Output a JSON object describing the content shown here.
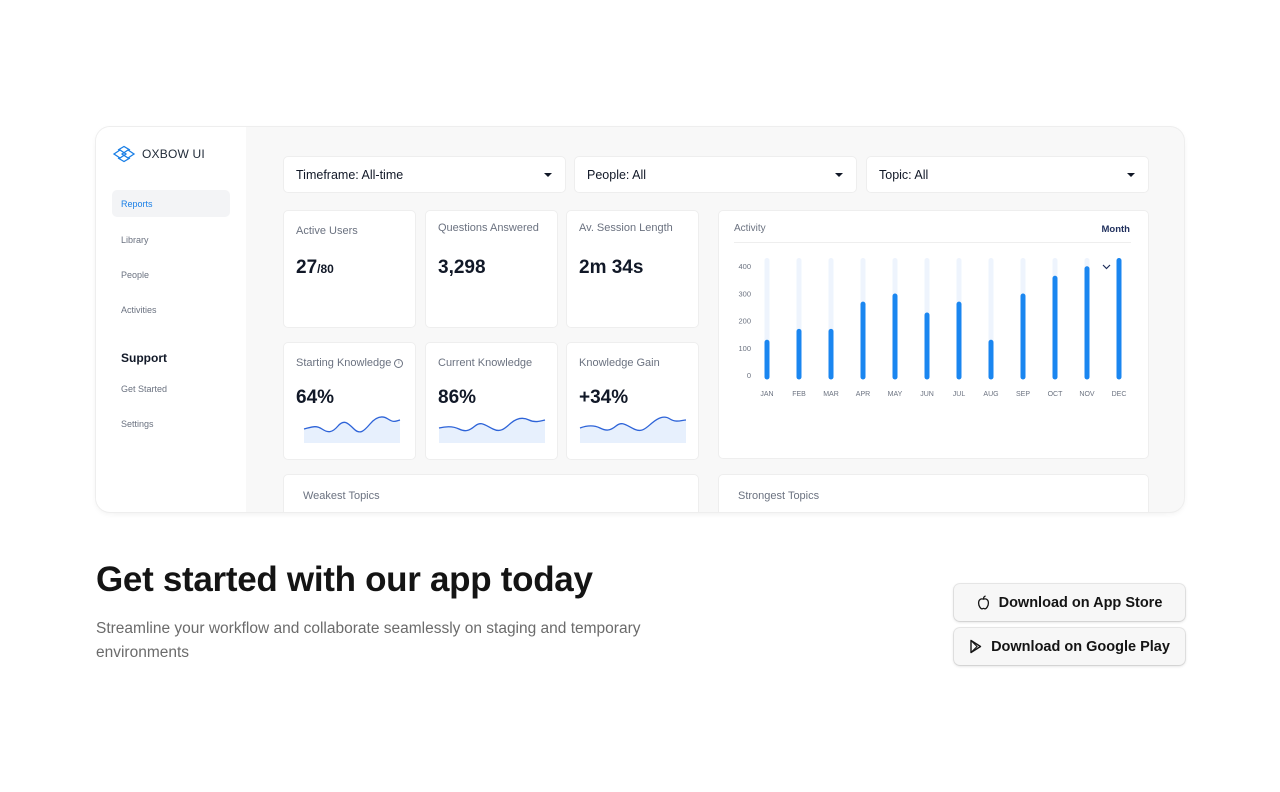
{
  "brand": {
    "name": "OXBOW UI",
    "icon": "oxbow-logo-icon",
    "accent": "#1a7fe6"
  },
  "sidebar": {
    "items": [
      {
        "label": "Reports",
        "active": true
      },
      {
        "label": "Library"
      },
      {
        "label": "People"
      },
      {
        "label": "Activities"
      }
    ],
    "support_heading": "Support",
    "support_items": [
      {
        "label": "Get Started"
      },
      {
        "label": "Settings"
      }
    ]
  },
  "filters": [
    {
      "label": "Timeframe: All-time"
    },
    {
      "label": "People: All"
    },
    {
      "label": "Topic: All"
    }
  ],
  "stats": {
    "active_users": {
      "label": "Active Users",
      "value": "27",
      "suffix": "/80"
    },
    "questions": {
      "label": "Questions Answered",
      "value": "3,298"
    },
    "session": {
      "label": "Av. Session Length",
      "value": "2m 34s"
    },
    "starting": {
      "label": "Starting Knowledge",
      "value": "64%",
      "info_icon": "info-icon"
    },
    "current": {
      "label": "Current Knowledge",
      "value": "86%"
    },
    "gain": {
      "label": "Knowledge Gain",
      "value": "+34%"
    }
  },
  "activity": {
    "title": "Activity",
    "period": "Month",
    "chart_data": {
      "type": "bar",
      "categories": [
        "JAN",
        "FEB",
        "MAR",
        "APR",
        "MAY",
        "JUN",
        "JUL",
        "AUG",
        "SEP",
        "OCT",
        "NOV",
        "DEC"
      ],
      "values": [
        120,
        160,
        160,
        260,
        290,
        220,
        260,
        120,
        290,
        355,
        390,
        420
      ],
      "yticks": [
        "400",
        "300",
        "200",
        "100",
        "0"
      ],
      "ylim": [
        0,
        420
      ],
      "grid": false,
      "bar_color": "#1a86f0",
      "track_color": "#eef4fd"
    }
  },
  "topics": {
    "weakest": "Weakest Topics",
    "strongest": "Strongest Topics"
  },
  "cta": {
    "headline": "Get started with our app today",
    "subtext": "Streamline your workflow and collaborate seamlessly on staging and temporary environments",
    "app_store": {
      "label": "Download on App Store",
      "icon": "apple-icon"
    },
    "google_play": {
      "label": "Download on Google Play",
      "icon": "play-icon"
    }
  }
}
